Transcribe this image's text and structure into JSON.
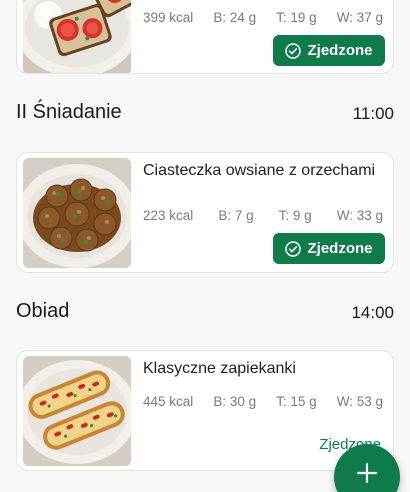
{
  "accent_color": "#0f7a4a",
  "sections": [
    {
      "meal": {
        "name": "",
        "kcal": "399 kcal",
        "protein": "B: 24 g",
        "fat": "T: 19 g",
        "carbs": "W: 37 g",
        "eaten_label": "Zjedzone",
        "eaten_state": "eaten",
        "image_icon": "toast-with-tomato-icon"
      }
    },
    {
      "title": "II Śniadanie",
      "time": "11:00",
      "meal": {
        "name": "Ciasteczka owsiane z orzechami",
        "kcal": "223 kcal",
        "protein": "B: 7 g",
        "fat": "T: 9 g",
        "carbs": "W: 33 g",
        "eaten_label": "Zjedzone",
        "eaten_state": "eaten",
        "image_icon": "oat-cookies-icon"
      }
    },
    {
      "title": "Obiad",
      "time": "14:00",
      "meal": {
        "name": "Klasyczne zapiekanki",
        "kcal": "445 kcal",
        "protein": "B: 30 g",
        "fat": "T: 15 g",
        "carbs": "W: 53 g",
        "eaten_label": "Zjedzone",
        "eaten_state": "not-eaten",
        "image_icon": "baguette-casserole-icon"
      }
    }
  ],
  "fab": {
    "icon": "plus-icon"
  }
}
